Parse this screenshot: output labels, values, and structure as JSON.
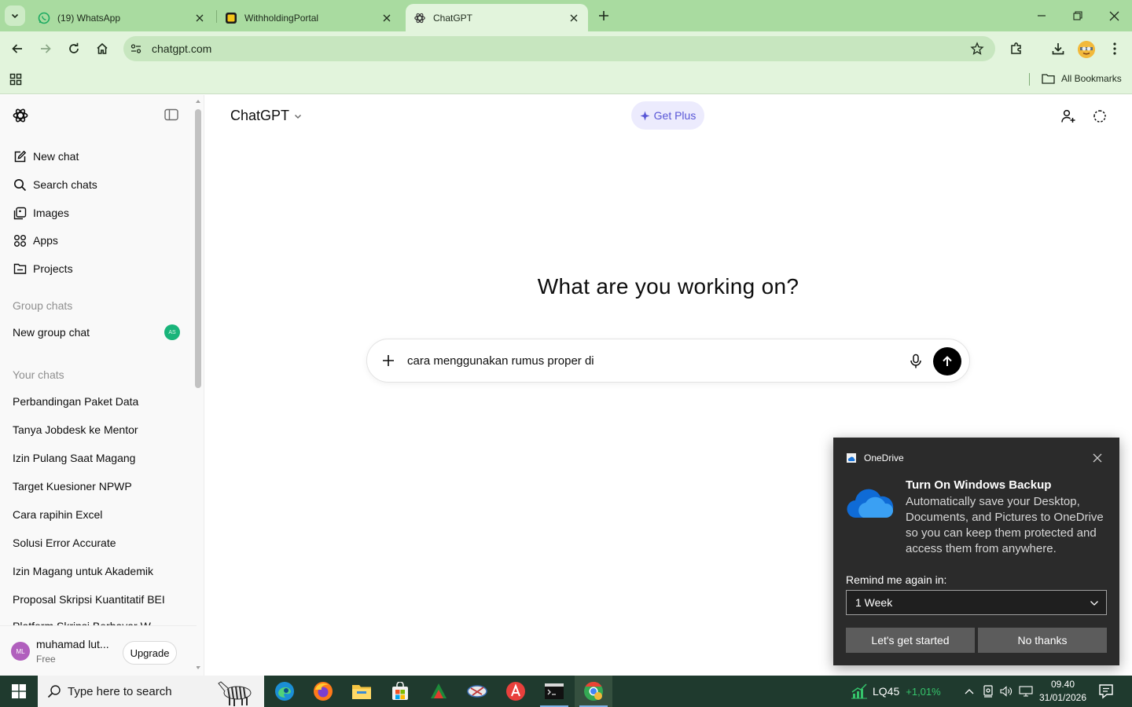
{
  "browser": {
    "tabs": [
      {
        "title": "(19) WhatsApp"
      },
      {
        "title": "WithholdingPortal"
      },
      {
        "title": "ChatGPT"
      }
    ],
    "url": "chatgpt.com",
    "all_bookmarks": "All Bookmarks"
  },
  "sidebar": {
    "nav": [
      {
        "label": "New chat",
        "icon": "compose-icon"
      },
      {
        "label": "Search chats",
        "icon": "search-icon"
      },
      {
        "label": "Images",
        "icon": "images-icon"
      },
      {
        "label": "Apps",
        "icon": "apps-icon"
      },
      {
        "label": "Projects",
        "icon": "folder-icon"
      }
    ],
    "group_chats_heading": "Group chats",
    "new_group_chat": "New group chat",
    "group_badge": "AS",
    "your_chats_heading": "Your chats",
    "chats": [
      "Perbandingan Paket Data",
      "Tanya Jobdesk ke Mentor",
      "Izin Pulang Saat Magang",
      "Target Kuesioner NPWP",
      "Cara rapihin Excel",
      "Solusi Error Accurate",
      "Izin Magang untuk Akademik",
      "Proposal Skripsi Kuantitatif BEI",
      "Platform Skripsi Berbayar W..."
    ],
    "user": {
      "initials": "ML",
      "name": "muhamad lut...",
      "plan": "Free",
      "upgrade_label": "Upgrade"
    }
  },
  "main": {
    "model": "ChatGPT",
    "get_plus": "Get Plus",
    "headline": "What are you working on?",
    "prompt_text": "cara menggunakan rumus proper di"
  },
  "toast": {
    "app": "OneDrive",
    "title": "Turn On Windows Backup",
    "body": "Automatically save your Desktop, Documents, and Pictures to OneDrive so you can keep them protected and access them from anywhere.",
    "remind_label": "Remind me again in:",
    "remind_value": "1 Week",
    "primary_button": "Let's get started",
    "secondary_button": "No thanks"
  },
  "taskbar": {
    "search_placeholder": "Type here to search",
    "stock_symbol": "LQ45",
    "stock_change": "+1,01%",
    "time": "09.40",
    "date": "31/01/2026"
  },
  "colors": {
    "browser_frame": "#a9dba0",
    "toolbar": "#e2f4dc",
    "send_button": "#000000",
    "get_plus_text": "#5856d6",
    "toast_bg": "#2b2b2b",
    "taskbar_bg": "#1f3a2e"
  }
}
